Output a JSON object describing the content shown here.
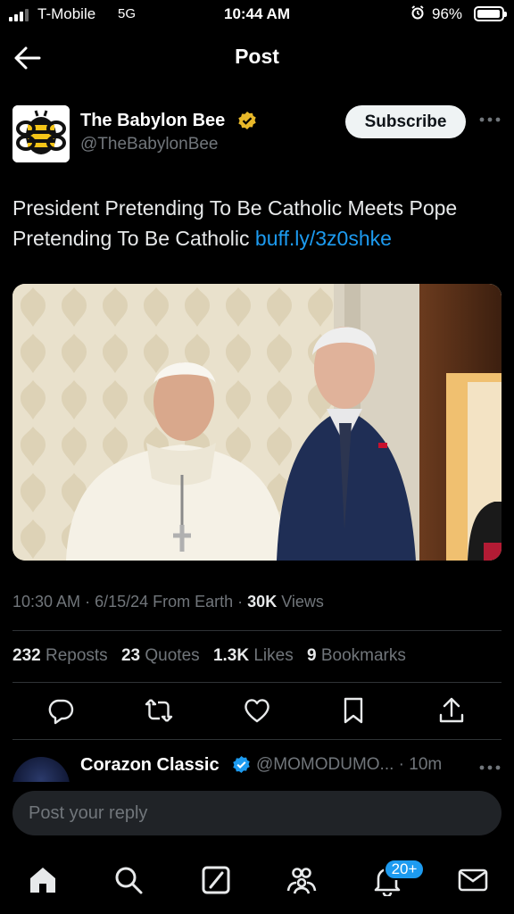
{
  "status_bar": {
    "carrier": "T-Mobile",
    "network": "5G",
    "time": "10:44 AM",
    "battery": "96%",
    "battery_level": 0.96,
    "signal_bars": 3
  },
  "header": {
    "title": "Post"
  },
  "post": {
    "author": {
      "name": "The Babylon Bee",
      "handle": "@TheBabylonBee",
      "verified_color": "#e8b829"
    },
    "subscribe_label": "Subscribe",
    "text": "President Pretending To Be Catholic Meets Pope Pretending To Be Catholic",
    "link": "buff.ly/3z0shke",
    "meta": {
      "time": "10:30 AM",
      "date": "6/15/24",
      "source": "From Earth",
      "views_count": "30K",
      "views_label": "Views"
    },
    "stats": {
      "reposts_count": "232",
      "reposts_label": "Reposts",
      "quotes_count": "23",
      "quotes_label": "Quotes",
      "likes_count": "1.3K",
      "likes_label": "Likes",
      "bookmarks_count": "9",
      "bookmarks_label": "Bookmarks"
    },
    "actions": [
      "reply-icon",
      "repost-icon",
      "like-icon",
      "bookmark-icon",
      "share-icon"
    ]
  },
  "reply": {
    "name": "Corazon Classic",
    "handle_time": "@MOMODUMO... · 10m",
    "verified_color": "#1d9bf0"
  },
  "reply_box": {
    "placeholder": "Post your reply"
  },
  "tab_bar": {
    "items": [
      "home-icon",
      "search-icon",
      "grok-icon",
      "communities-icon",
      "notifications-icon",
      "messages-icon"
    ],
    "notifications_badge": "20+"
  },
  "colors": {
    "accent": "#1d9bf0",
    "background": "#000000",
    "secondary_text": "#71767b"
  }
}
